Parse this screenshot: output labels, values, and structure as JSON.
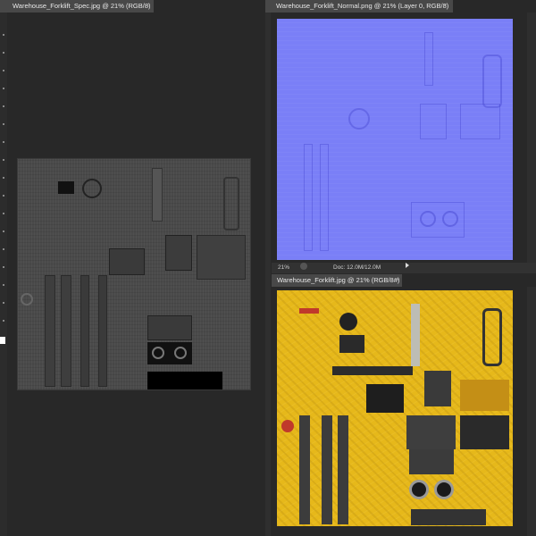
{
  "documents": {
    "spec": {
      "title": "Warehouse_Forklift_Spec.jpg @ 21% (RGB/8)",
      "close": "×"
    },
    "normal": {
      "title": "Warehouse_Forklift_Normal.png @ 21% (Layer 0, RGB/8)",
      "close": "×"
    },
    "diffuse": {
      "title": "Warehouse_Forklift.jpg @ 21% (RGB/8#)",
      "close": "×"
    }
  },
  "status_bar": {
    "zoom": "21%",
    "doc_info": "Doc: 12.0M/12.0M"
  },
  "colors": {
    "normal_map": "#7a7ff7",
    "diffuse_map": "#e6b81a",
    "spec_map": "#4a4a4a"
  }
}
